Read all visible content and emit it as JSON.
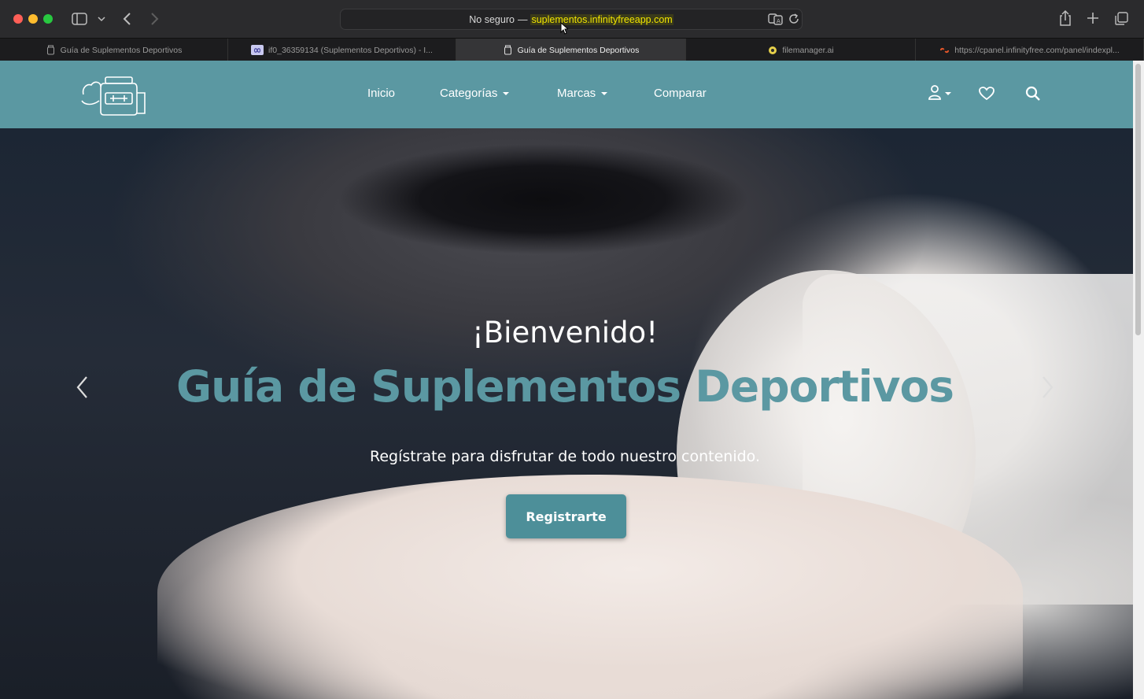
{
  "browser": {
    "address": {
      "security_label": "No seguro",
      "separator": "—",
      "url": "suplementos.infinityfreeapp.com"
    },
    "tabs": [
      {
        "label": "Guía de Suplementos Deportivos",
        "icon": "jar-icon",
        "active": false
      },
      {
        "label": "if0_36359134 (Suplementos Deportivos) - I...",
        "icon": "infinity-icon",
        "active": false
      },
      {
        "label": "Guía de Suplementos Deportivos",
        "icon": "jar-icon",
        "active": true
      },
      {
        "label": "filemanager.ai",
        "icon": "filemanager-icon",
        "active": false
      },
      {
        "label": "https://cpanel.infinityfree.com/panel/indexpl...",
        "icon": "cpanel-icon",
        "active": false
      }
    ]
  },
  "navbar": {
    "brand_color": "#5b98a2",
    "links": {
      "home": "Inicio",
      "categories": "Categorías",
      "brands": "Marcas",
      "compare": "Comparar"
    },
    "icons": [
      "user-icon",
      "heart-icon",
      "search-icon"
    ]
  },
  "hero": {
    "welcome": "¡Bienvenido!",
    "title": "Guía de Suplementos Deportivos",
    "subtitle": "Regístrate para disfrutar de todo nuestro contenido.",
    "cta_label": "Registrarte"
  }
}
